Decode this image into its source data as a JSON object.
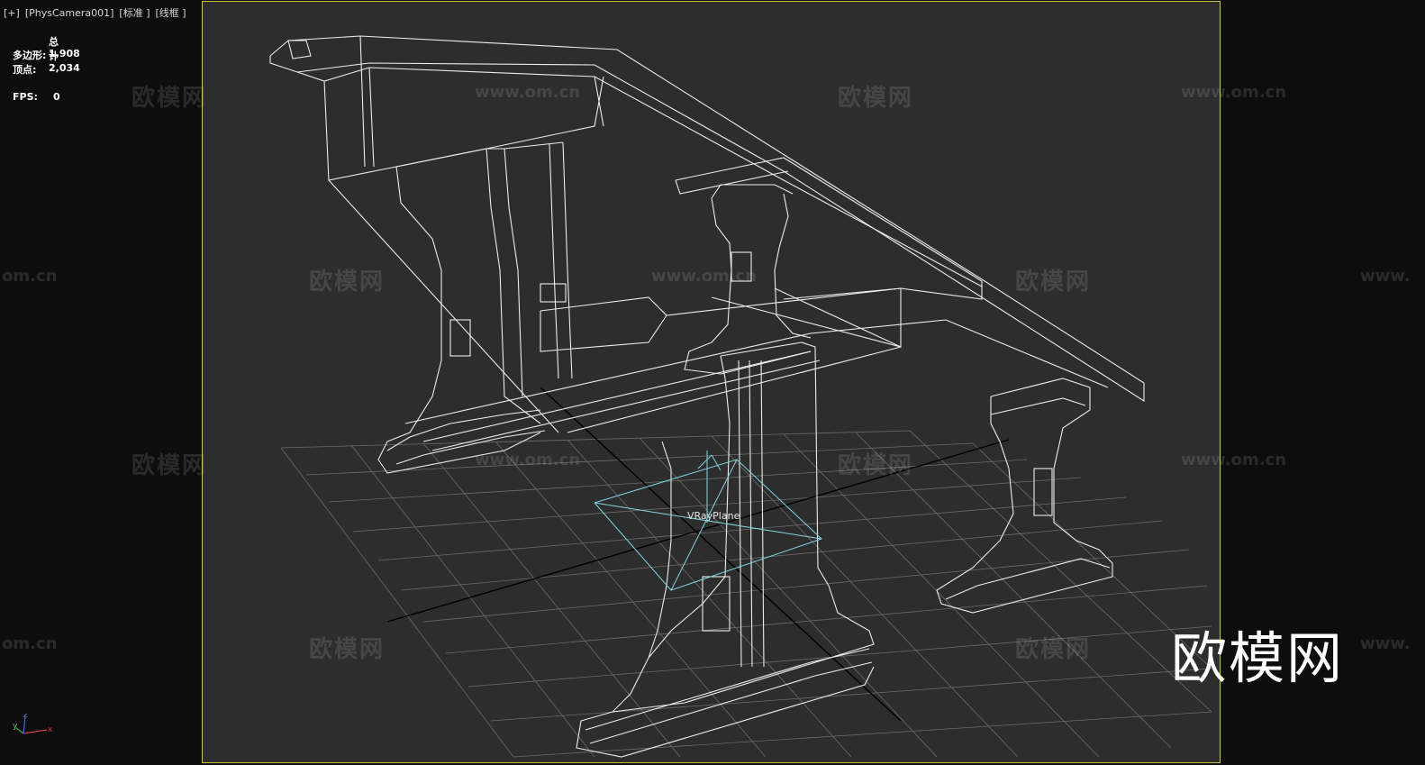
{
  "viewport": {
    "label_parts": [
      "[+]",
      "[PhysCamera001]",
      "[标准 ]",
      "[线框 ]"
    ],
    "colors": {
      "background": "#0d0d0d",
      "frame_fill": "#2d2d2d",
      "safe_frame_border": "#c8c43a",
      "wireframe": "#ececec",
      "light_gizmo": "#7fd6e0",
      "grid": "#8a8a8a"
    }
  },
  "stats": {
    "header": "总计",
    "polygons_label": "多边形:",
    "polygons_value": "1,908",
    "vertices_label": "顶点:",
    "vertices_value": "2,034",
    "fps_label": "FPS:",
    "fps_value": "0"
  },
  "scene": {
    "light_label": "VRayPlane"
  },
  "watermarks": {
    "cn_text": "欧模网",
    "url_text": "www.om.cn",
    "url_partial": "om.cn",
    "url_partial_right": "www.",
    "logo_text": "欧模网"
  },
  "axis": {
    "x": "x",
    "y": "y",
    "z": "z"
  }
}
